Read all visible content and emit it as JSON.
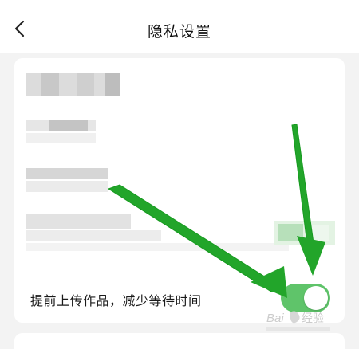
{
  "header": {
    "title": "隐私设置",
    "back_icon": "chevron-left-icon"
  },
  "settings": {
    "upload_early_label": "提前上传作品，减少等待时间",
    "upload_early_enabled": true
  },
  "colors": {
    "toggle_on": "#5fc46a",
    "annotation_arrow": "#22a52a",
    "background": "#f3f3f3",
    "card": "#ffffff"
  }
}
